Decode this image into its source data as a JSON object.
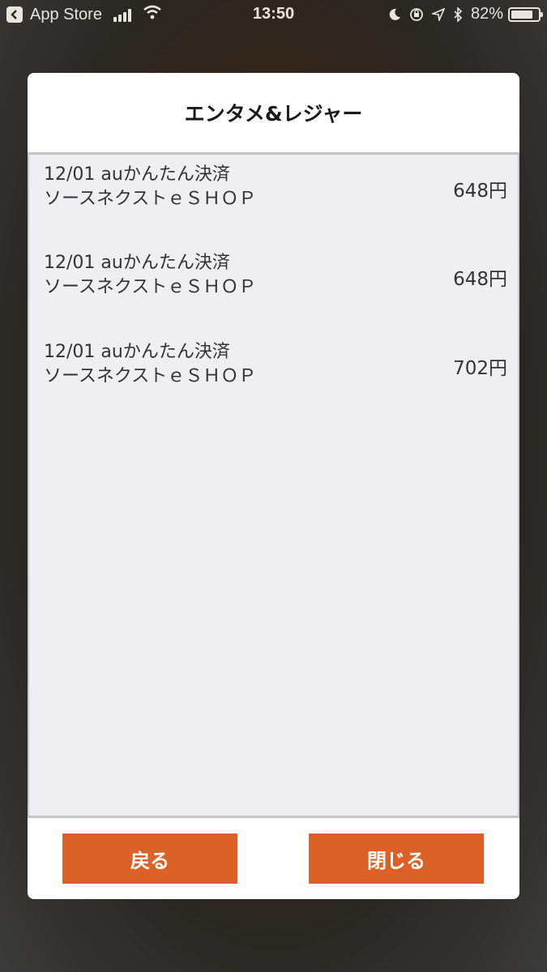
{
  "status_bar": {
    "back_app": "App Store",
    "time": "13:50",
    "battery_percent": "82%",
    "battery_level": 0.82
  },
  "modal": {
    "title": "エンタメ&レジャー",
    "items": [
      {
        "date": "12/01",
        "method": "auかんたん決済",
        "merchant": "ソースネクストｅＳＨＯＰ",
        "amount": "648円"
      },
      {
        "date": "12/01",
        "method": "auかんたん決済",
        "merchant": "ソースネクストｅＳＨＯＰ",
        "amount": "648円"
      },
      {
        "date": "12/01",
        "method": "auかんたん決済",
        "merchant": "ソースネクストｅＳＨＯＰ",
        "amount": "702円"
      }
    ],
    "buttons": {
      "back_label": "戻る",
      "close_label": "閉じる"
    }
  },
  "colors": {
    "accent": "#dc6127",
    "list_background": "#eeeef3"
  }
}
